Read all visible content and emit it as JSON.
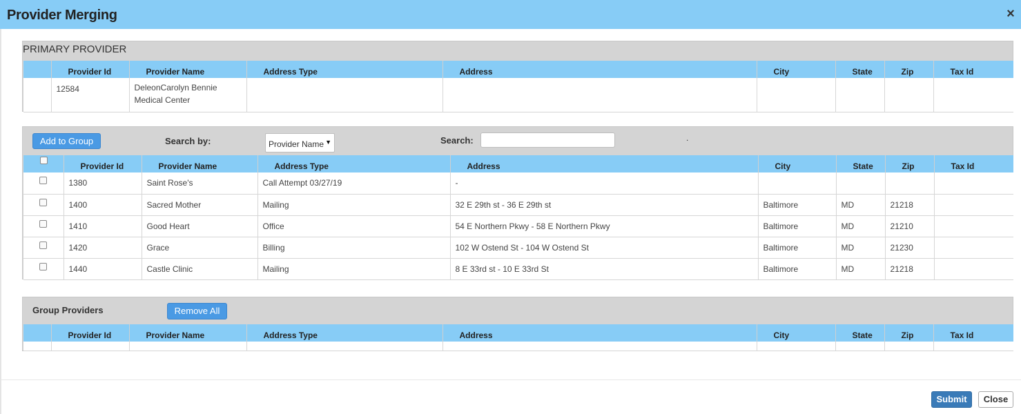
{
  "window": {
    "title": "Provider Merging",
    "close_glyph": "×"
  },
  "primary": {
    "heading": "PRIMARY PROVIDER",
    "columns": [
      "",
      "Provider Id",
      "Provider Name",
      "Address Type",
      "Address",
      "City",
      "State",
      "Zip",
      "Tax Id"
    ],
    "row": {
      "id": "12584",
      "name_line1": "DeleonCarolyn Bennie",
      "name_line2": "Medical Center",
      "address_type": "",
      "address": "",
      "city": "",
      "state": "",
      "zip": "",
      "tax_id": ""
    }
  },
  "search": {
    "add_button": "Add to Group",
    "search_by_label": "Search by:",
    "search_by_value": "Provider Name",
    "search_label": "Search:",
    "search_value": "",
    "dot": ".",
    "columns": [
      "",
      "Provider Id",
      "Provider Name",
      "Address Type",
      "Address",
      "City",
      "State",
      "Zip",
      "Tax Id"
    ],
    "rows": [
      {
        "id": "1380",
        "name": "Saint Rose's",
        "address_type": "Call Attempt 03/27/19",
        "address": "-",
        "city": "",
        "state": "",
        "zip": "",
        "tax_id": ""
      },
      {
        "id": "1400",
        "name": "Sacred Mother",
        "address_type": "Mailing",
        "address": "32 E 29th st - 36 E 29th st",
        "city": "Baltimore",
        "state": "MD",
        "zip": "21218",
        "tax_id": ""
      },
      {
        "id": "1410",
        "name": "Good Heart",
        "address_type": "Office",
        "address": "54 E Northern Pkwy - 58 E Northern Pkwy",
        "city": "Baltimore",
        "state": "MD",
        "zip": "21210",
        "tax_id": ""
      },
      {
        "id": "1420",
        "name": "Grace",
        "address_type": "Billing",
        "address": "102 W Ostend St - 104 W Ostend St",
        "city": "Baltimore",
        "state": "MD",
        "zip": "21230",
        "tax_id": ""
      },
      {
        "id": "1440",
        "name": "Castle Clinic",
        "address_type": "Mailing",
        "address": "8 E 33rd st - 10 E 33rd St",
        "city": "Baltimore",
        "state": "MD",
        "zip": "21218",
        "tax_id": ""
      }
    ]
  },
  "group": {
    "heading": "Group Providers",
    "remove_button": "Remove All",
    "columns": [
      "",
      "Provider Id",
      "Provider Name",
      "Address Type",
      "Address",
      "City",
      "State",
      "Zip",
      "Tax Id"
    ]
  },
  "footer": {
    "submit": "Submit",
    "close": "Close"
  },
  "colors": {
    "header_blue": "#87ccf6",
    "button_blue": "#4a9ae4",
    "submit_blue": "#3a7bb8",
    "panel_gray": "#d4d4d4"
  }
}
